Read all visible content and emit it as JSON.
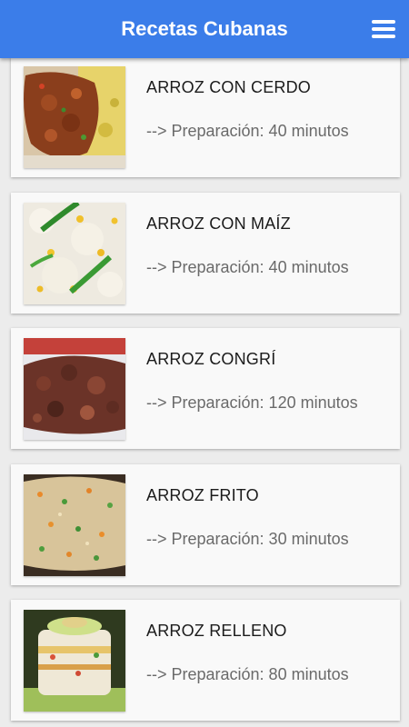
{
  "app_bar": {
    "title": "Recetas Cubanas",
    "menu_icon": "hamburger-menu-icon",
    "background_color": "#3b7de9"
  },
  "recipes": [
    {
      "name": "ARROZ CON CERDO",
      "prep": "--> Preparación: 40 minutos",
      "image": "arroz-con-cerdo-photo"
    },
    {
      "name": "ARROZ CON MAÍZ",
      "prep": "--> Preparación: 40 minutos",
      "image": "arroz-con-maiz-photo"
    },
    {
      "name": "ARROZ CONGRÍ",
      "prep": "--> Preparación: 120 minutos",
      "image": "arroz-congri-photo"
    },
    {
      "name": "ARROZ FRITO",
      "prep": "--> Preparación: 30 minutos",
      "image": "arroz-frito-photo"
    },
    {
      "name": "ARROZ RELLENO",
      "prep": "--> Preparación: 80 minutos",
      "image": "arroz-relleno-photo"
    }
  ]
}
